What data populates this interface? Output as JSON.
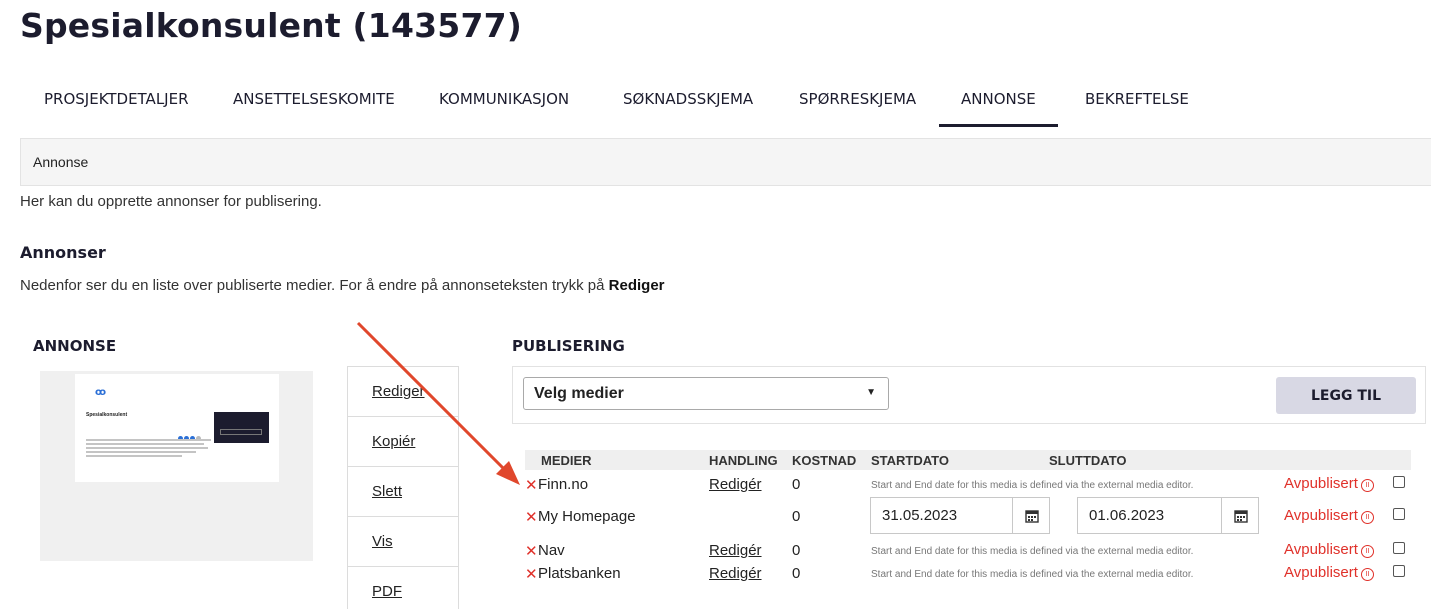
{
  "page": {
    "title": "Spesialkonsulent (143577)"
  },
  "tabs": [
    {
      "label": "PROSJEKTDETALJER",
      "active": false
    },
    {
      "label": "ANSETTELSESKOMITE",
      "active": false
    },
    {
      "label": "KOMMUNIKASJON",
      "active": false
    },
    {
      "label": "SØKNADSSKJEMA",
      "active": false
    },
    {
      "label": "SPØRRESKJEMA",
      "active": false
    },
    {
      "label": "ANNONSE",
      "active": true
    },
    {
      "label": "BEKREFTELSE",
      "active": false
    }
  ],
  "section": {
    "bar_label": "Annonse",
    "intro": "Her kan du opprette annonser for publisering.",
    "heading": "Annonser",
    "desc_prefix": "Nedenfor ser du en liste over publiserte medier. For å endre på annonseteksten trykk på ",
    "desc_bold": "Rediger"
  },
  "ad": {
    "heading": "ANNONSE",
    "preview": {
      "logo": "ꝏ",
      "title": "Spesialkonsulent"
    },
    "actions": [
      "Rediger",
      "Kopiér",
      "Slett",
      "Vis",
      "PDF"
    ]
  },
  "publishing": {
    "heading": "PUBLISERING",
    "select_value": "Velg medier",
    "add_label": "LEGG TIL",
    "columns": {
      "media": "MEDIER",
      "action": "HANDLING",
      "cost": "KOSTNAD",
      "start": "STARTDATO",
      "end": "SLUTTDATO"
    },
    "rows": [
      {
        "name": "Finn.no",
        "edit": "Redigér",
        "cost": "0",
        "note": "Start and End date for this media is defined via the external media editor.",
        "status": "Avpublisert"
      },
      {
        "name": "My Homepage",
        "edit": "",
        "cost": "0",
        "start": "31.05.2023",
        "end": "01.06.2023",
        "status": "Avpublisert"
      },
      {
        "name": "Nav",
        "edit": "Redigér",
        "cost": "0",
        "note": "Start and End date for this media is defined via the external media editor.",
        "status": "Avpublisert"
      },
      {
        "name": "Platsbanken",
        "edit": "Redigér",
        "cost": "0",
        "note": "Start and End date for this media is defined via the external media editor.",
        "status": "Avpublisert"
      }
    ]
  },
  "colors": {
    "accent": "#1c1c2e",
    "danger": "#e0312a",
    "annotation_arrow": "#e0472c"
  },
  "icons": {
    "remove": "close-x-icon",
    "calendar": "calendar-icon",
    "status": "pause-circle-icon",
    "dropdown": "caret-down-icon"
  }
}
